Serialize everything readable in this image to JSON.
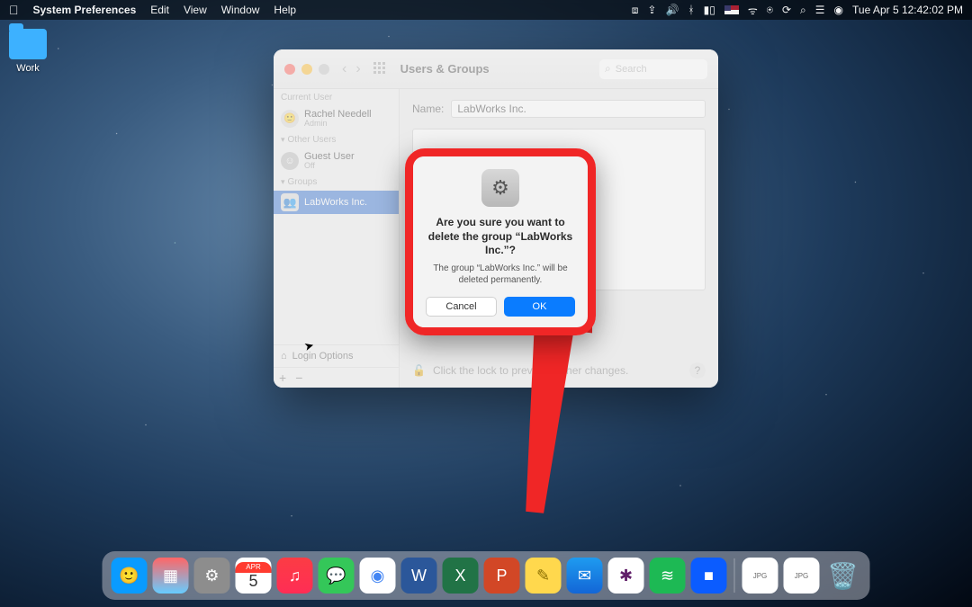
{
  "menubar": {
    "app": "System Preferences",
    "items": [
      "Edit",
      "View",
      "Window",
      "Help"
    ],
    "clock": "Tue Apr 5  12:42:02 PM"
  },
  "desktop": {
    "folder": "Work"
  },
  "window": {
    "title": "Users & Groups",
    "search_placeholder": "Search",
    "name_label": "Name:",
    "name_value": "LabWorks Inc.",
    "sidebar": {
      "current_label": "Current User",
      "current": {
        "name": "Rachel Needell",
        "role": "Admin"
      },
      "other_label": "Other Users",
      "guest": {
        "name": "Guest User",
        "role": "Off"
      },
      "groups_label": "Groups",
      "group": {
        "name": "LabWorks Inc."
      },
      "login_options": "Login Options"
    },
    "lock_text": "Click the lock to prevent further changes."
  },
  "dialog": {
    "title": "Are you sure you want to delete the group “LabWorks Inc.”?",
    "message": "The group “LabWorks Inc.” will be deleted permanently.",
    "cancel": "Cancel",
    "ok": "OK"
  },
  "dock": {
    "apps": [
      {
        "name": "finder",
        "bg": "#0a9bff",
        "glyph": "🙂"
      },
      {
        "name": "launchpad",
        "bg": "#e9e9e9",
        "glyph": "▦"
      },
      {
        "name": "system-preferences",
        "bg": "#8d8d8d",
        "glyph": "⚙"
      },
      {
        "name": "calendar",
        "bg": "#ffffff",
        "glyph": "5"
      },
      {
        "name": "music",
        "bg": "#fc3158",
        "glyph": "♫"
      },
      {
        "name": "messages",
        "bg": "#34c759",
        "glyph": "✉"
      },
      {
        "name": "chrome",
        "bg": "#ffffff",
        "glyph": "●"
      },
      {
        "name": "word",
        "bg": "#2b579a",
        "glyph": "W"
      },
      {
        "name": "excel",
        "bg": "#217346",
        "glyph": "X"
      },
      {
        "name": "powerpoint",
        "bg": "#d24726",
        "glyph": "P"
      },
      {
        "name": "notes",
        "bg": "#ffd84d",
        "glyph": "✎"
      },
      {
        "name": "mail",
        "bg": "#1e9bf0",
        "glyph": "✉"
      },
      {
        "name": "slack",
        "bg": "#ffffff",
        "glyph": "✻"
      },
      {
        "name": "spotify",
        "bg": "#1db954",
        "glyph": "▶"
      },
      {
        "name": "zoom",
        "bg": "#0b5cff",
        "glyph": "■"
      }
    ],
    "cal_month": "APR",
    "cal_day": "5"
  }
}
